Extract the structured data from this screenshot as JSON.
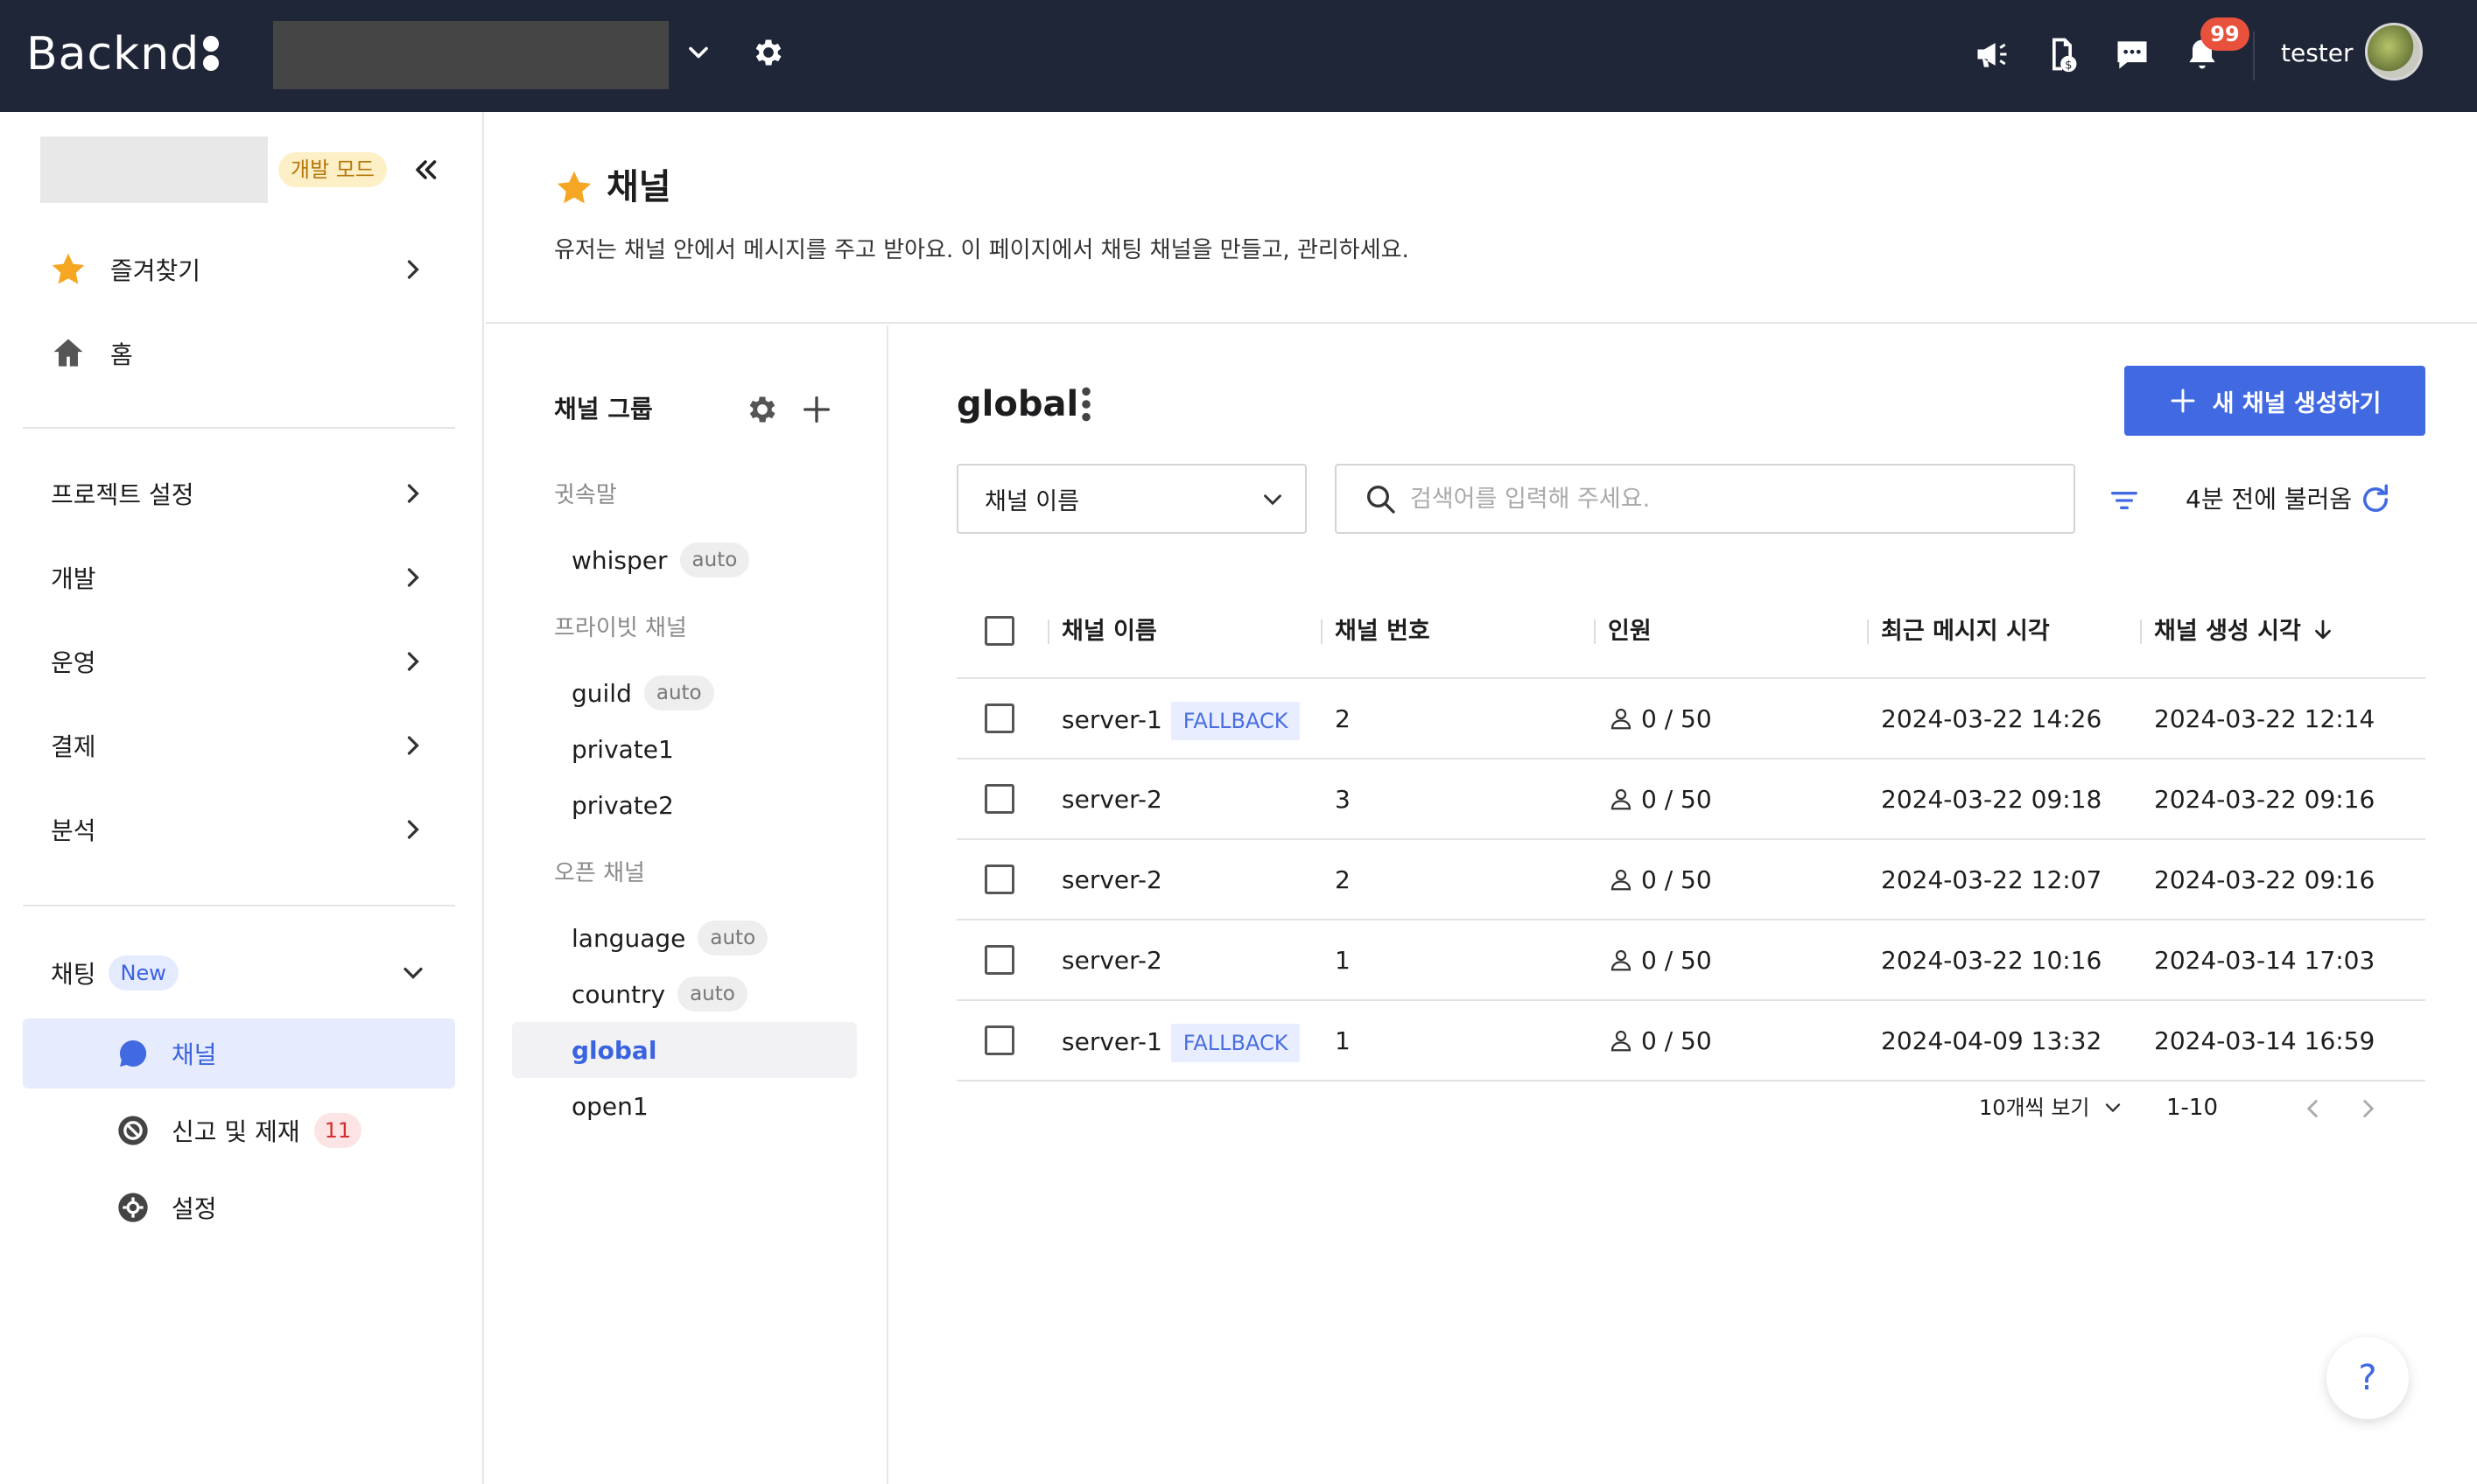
{
  "topbar": {
    "logo": "Backnd",
    "username": "tester",
    "notification_count": "99",
    "icons": [
      "announcement-icon",
      "document-dollar-icon",
      "chat-icon",
      "bell-icon"
    ]
  },
  "sidebar": {
    "dev_mode_badge": "개발 모드",
    "favorites": "즐겨찾기",
    "home": "홈",
    "project_settings": "프로젝트 설정",
    "develop": "개발",
    "operate": "운영",
    "payment": "결제",
    "analytics": "분석",
    "chatting": "채팅",
    "new_badge": "New",
    "sub_items": [
      {
        "label": "채널",
        "icon": "chat-bubble-icon",
        "active": true
      },
      {
        "label": "신고 및 제재",
        "icon": "ban-icon",
        "count": "11"
      },
      {
        "label": "설정",
        "icon": "settings-icon"
      }
    ]
  },
  "page": {
    "title": "채널",
    "description": "유저는 채널 안에서 메시지를 주고 받아요. 이 페이지에서 채팅 채널을 만들고, 관리하세요."
  },
  "groups": {
    "title": "채널 그룹",
    "sections": [
      {
        "label": "귓속말",
        "items": [
          {
            "label": "whisper",
            "badge": "auto"
          }
        ]
      },
      {
        "label": "프라이빗 채널",
        "items": [
          {
            "label": "guild",
            "badge": "auto"
          },
          {
            "label": "private1"
          },
          {
            "label": "private2"
          }
        ]
      },
      {
        "label": "오픈 채널",
        "items": [
          {
            "label": "language",
            "badge": "auto"
          },
          {
            "label": "country",
            "badge": "auto"
          },
          {
            "label": "global",
            "active": true
          },
          {
            "label": "open1"
          }
        ]
      }
    ]
  },
  "main": {
    "title": "global",
    "create_button": "새 채널 생성하기",
    "search_field": "채널 이름",
    "search_placeholder": "검색어를 입력해 주세요.",
    "refresh_label": "4분 전에 불러옴",
    "columns": [
      "채널 이름",
      "채널 번호",
      "인원",
      "최근 메시지 시각",
      "채널 생성 시각"
    ],
    "rows": [
      {
        "name": "server-1",
        "tag": "FALLBACK",
        "number": "2",
        "members": "0 / 50",
        "last_message": "2024-03-22 14:26",
        "created": "2024-03-22 12:14"
      },
      {
        "name": "server-2",
        "tag": "",
        "number": "3",
        "members": "0 / 50",
        "last_message": "2024-03-22 09:18",
        "created": "2024-03-22 09:16"
      },
      {
        "name": "server-2",
        "tag": "",
        "number": "2",
        "members": "0 / 50",
        "last_message": "2024-03-22 12:07",
        "created": "2024-03-22 09:16"
      },
      {
        "name": "server-2",
        "tag": "",
        "number": "1",
        "members": "0 / 50",
        "last_message": "2024-03-22 10:16",
        "created": "2024-03-14 17:03"
      },
      {
        "name": "server-1",
        "tag": "FALLBACK",
        "number": "1",
        "members": "0 / 50",
        "last_message": "2024-04-09 13:32",
        "created": "2024-03-14 16:59"
      }
    ],
    "per_page": "10개씩 보기",
    "range": "1-10"
  },
  "help_label": "?",
  "colors": {
    "topbar": "#1f2638",
    "accent": "#4169e1",
    "star": "#f5a623"
  }
}
